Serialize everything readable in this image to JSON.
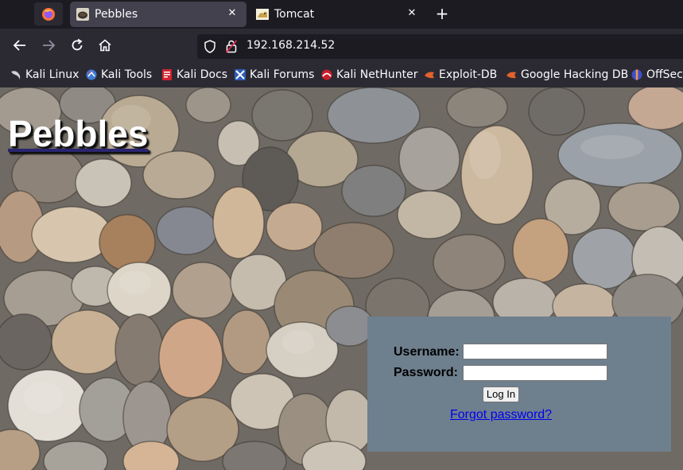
{
  "browser": {
    "tabs": [
      {
        "label": "Pebbles",
        "active": true
      },
      {
        "label": "Tomcat",
        "active": false
      }
    ],
    "address": "192.168.214.52",
    "bookmarks": [
      {
        "label": "Kali Linux",
        "icon": "kali-dragon-icon"
      },
      {
        "label": "Kali Tools",
        "icon": "kali-tools-icon"
      },
      {
        "label": "Kali Docs",
        "icon": "kali-docs-icon"
      },
      {
        "label": "Kali Forums",
        "icon": "kali-forums-icon"
      },
      {
        "label": "Kali NetHunter",
        "icon": "kali-nethunter-icon"
      },
      {
        "label": "Exploit-DB",
        "icon": "exploit-db-icon"
      },
      {
        "label": "Google Hacking DB",
        "icon": "ghdb-icon"
      },
      {
        "label": "OffSec",
        "icon": "offsec-icon"
      }
    ]
  },
  "page": {
    "title": "Pebbles",
    "login": {
      "username_label": "Username:",
      "password_label": "Password:",
      "username_value": "",
      "password_value": "",
      "submit_label": "Log In",
      "forgot_label": "Forgot password?"
    }
  },
  "colors": {
    "browser_bg": "#1c1b22",
    "toolbar_bg": "#2b2a33",
    "active_tab": "#42414d",
    "login_panel": "#6e7f8e",
    "link": "#0000ee"
  }
}
